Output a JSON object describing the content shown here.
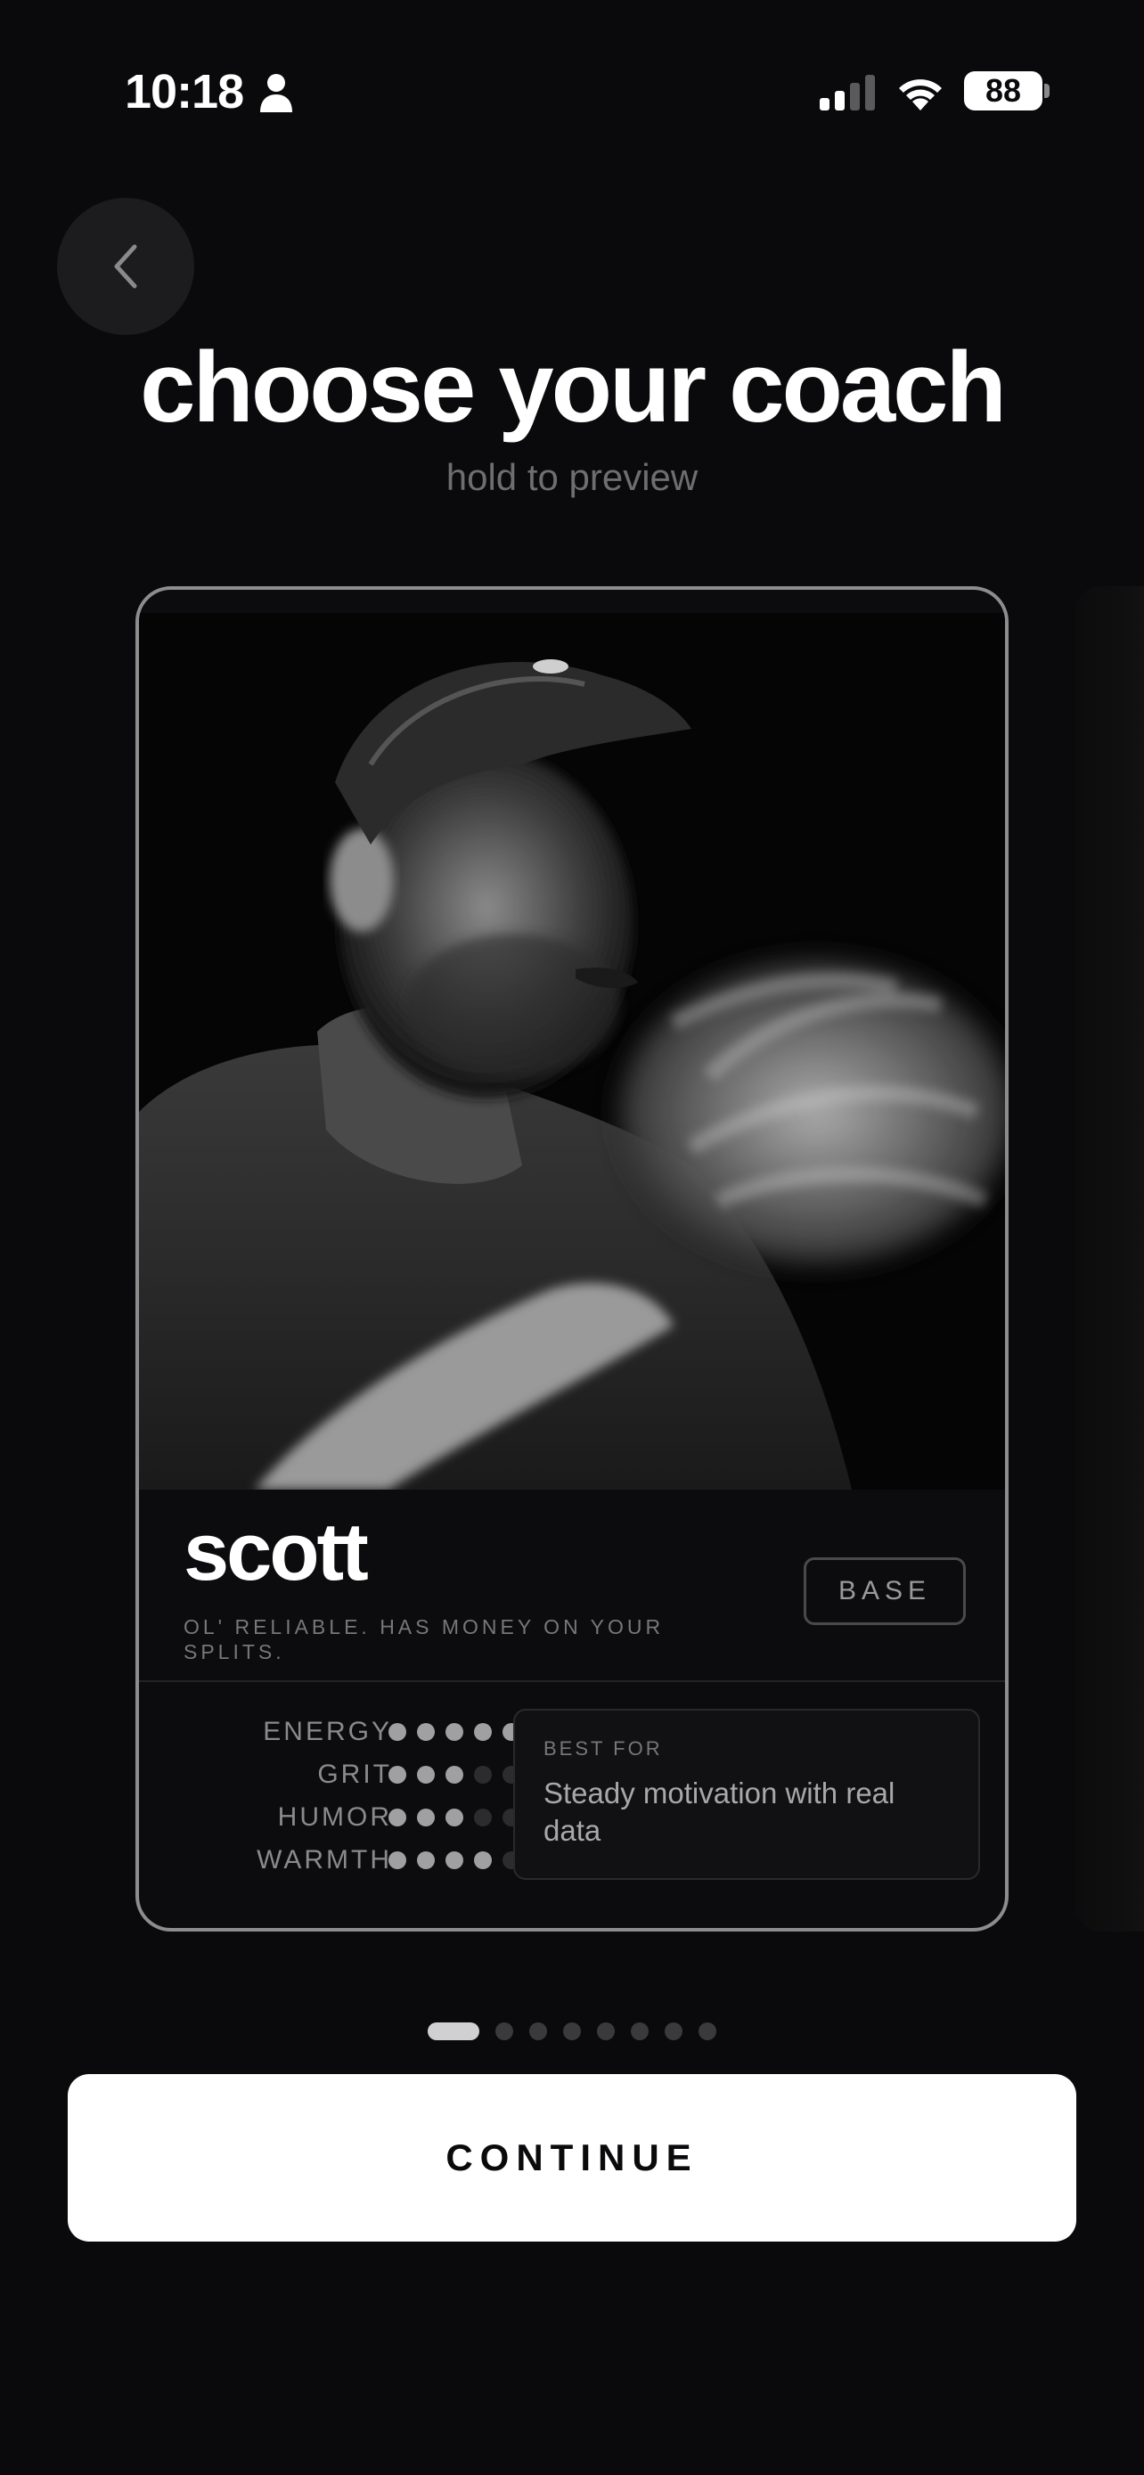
{
  "status_bar": {
    "time": "10:18",
    "battery": "88",
    "icons": [
      "person-icon",
      "signal-icon",
      "wifi-icon",
      "battery-icon"
    ]
  },
  "header": {
    "back_icon": "chevron-left-icon",
    "title": "choose your coach",
    "subtitle": "hold to preview"
  },
  "coach": {
    "name": "scott",
    "tagline": "OL' RELIABLE. HAS MONEY ON YOUR SPLITS.",
    "tier": "BASE",
    "stats": [
      {
        "label": "ENERGY",
        "level": 5,
        "max": 5
      },
      {
        "label": "GRIT",
        "level": 3,
        "max": 5
      },
      {
        "label": "HUMOR",
        "level": 3,
        "max": 5
      },
      {
        "label": "WARMTH",
        "level": 4,
        "max": 5
      }
    ],
    "best_for_label": "BEST FOR",
    "best_for": "Steady motivation with real data"
  },
  "pager": {
    "count": 8,
    "active_index": 0
  },
  "continue_label": "CONTINUE",
  "colors": {
    "background": "#0a0a0c",
    "button": "#ffffff",
    "dot_on": "#a0a0a2",
    "dot_off": "#2c2c2e"
  }
}
